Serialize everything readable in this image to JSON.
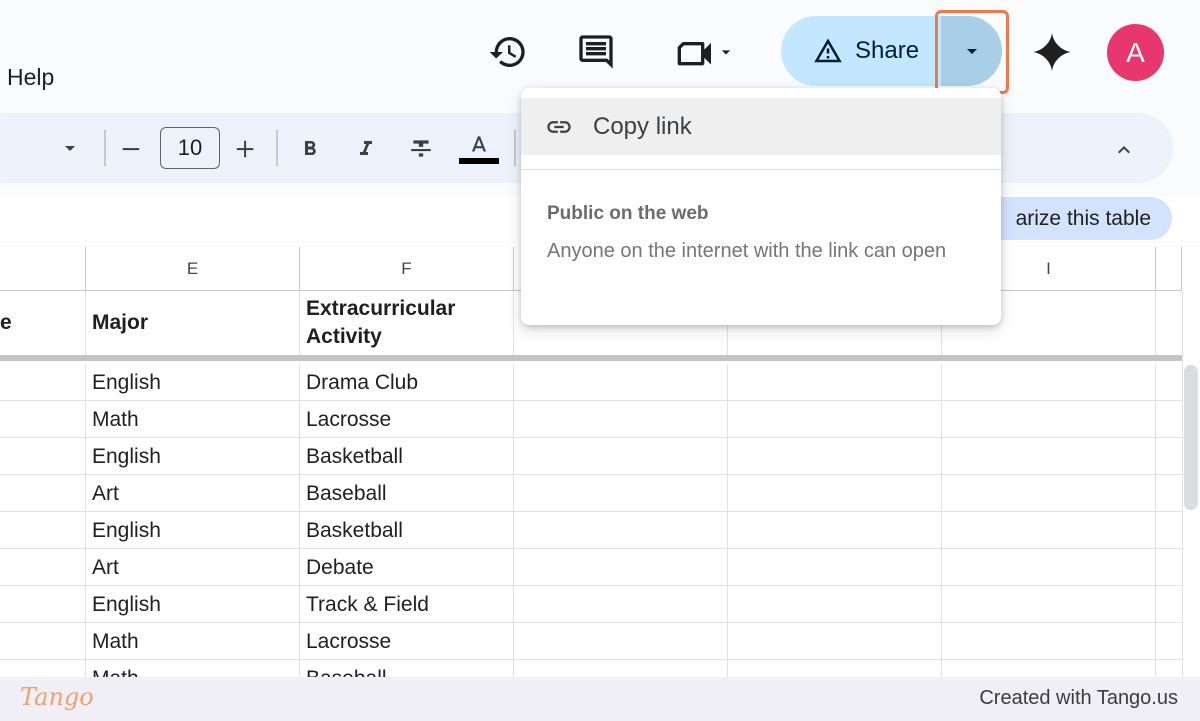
{
  "menu": {
    "help": "Help"
  },
  "header": {
    "share_label": "Share",
    "avatar_letter": "A",
    "accent_color": "#c2e7ff",
    "highlight_color": "#f0784d"
  },
  "toolbar": {
    "font_size": "10"
  },
  "summarize": {
    "label": "arize this table"
  },
  "columns": {
    "partial_left": "",
    "E": "E",
    "F": "F",
    "G": "",
    "H": "",
    "I": "I"
  },
  "header_row": {
    "partial": "e",
    "major": "Major",
    "activity": "Extracurricular Activity"
  },
  "rows": [
    {
      "major": "English",
      "activity": "Drama Club"
    },
    {
      "major": "Math",
      "activity": "Lacrosse"
    },
    {
      "major": "English",
      "activity": "Basketball"
    },
    {
      "major": "Art",
      "activity": "Baseball"
    },
    {
      "major": "English",
      "activity": "Basketball"
    },
    {
      "major": "Art",
      "activity": "Debate"
    },
    {
      "major": "English",
      "activity": "Track & Field"
    },
    {
      "major": "Math",
      "activity": "Lacrosse"
    },
    {
      "major": "Math",
      "activity": "Baseball"
    }
  ],
  "share_menu": {
    "copy_link": "Copy link",
    "visibility_title": "Public on the web",
    "visibility_desc": "Anyone on the internet with the link can open"
  },
  "footer": {
    "logo": "Tango",
    "credit": "Created with Tango.us"
  }
}
